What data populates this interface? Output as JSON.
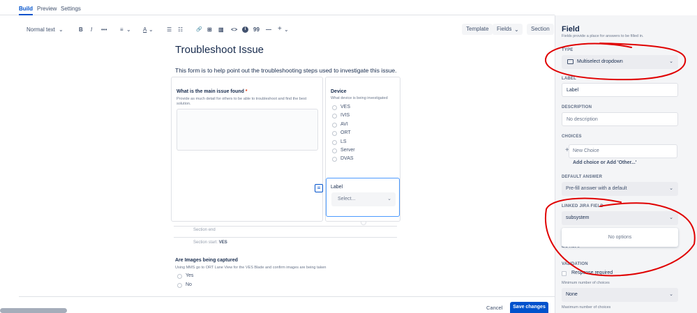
{
  "tabs": [
    {
      "label": "Build",
      "active": true
    },
    {
      "label": "Preview",
      "active": false
    },
    {
      "label": "Settings",
      "active": false
    }
  ],
  "toolbar": {
    "text_style": "Normal text",
    "text_style_chevron": "⌄",
    "bold": "B",
    "italic": "I",
    "more": "•••",
    "align": "≡",
    "align_chevron": "⌄",
    "text_color": "A",
    "color_chevron": "⌄",
    "bullet_list": "☰",
    "numbered_list": "☷",
    "link": "🔗",
    "table": "⊞",
    "layout": "▥",
    "code": "<>",
    "info": "i",
    "quote": "99",
    "divider": "—",
    "insert": "+",
    "insert_chevron": "⌄",
    "template_label": "Template",
    "fields_label": "Fields",
    "fields_chevron": "⌄",
    "section_label": "Section"
  },
  "form": {
    "title": "Troubleshoot Issue",
    "description": "This form is to help point out the troubleshooting steps used to investigate this issue.",
    "q_main_issue": {
      "title": "What is the main issue found",
      "required_mark": "*",
      "description": "Provide as much detail for others to be able to troubleshoot and find the best solution."
    },
    "q_device": {
      "title": "Device",
      "description": "What device is being investigated",
      "options": [
        "VES",
        "IVIS",
        "AVI",
        "ORT",
        "LS",
        "Server",
        "DVAS"
      ]
    },
    "q_label": {
      "title": "Label",
      "select_placeholder": "Select...",
      "chevron": "⌄"
    },
    "drag_handle_glyph": "≡",
    "section_end": "Section end",
    "section_start_prefix": "Section start:",
    "section_start_name": "VES",
    "q_images": {
      "title": "Are Images being captured",
      "description": "Using MMS go to ORT Lane View for the VES Blade and confirm images are being taken",
      "options": [
        "Yes",
        "No"
      ]
    },
    "cancel_label": "Cancel",
    "save_label": "Save changes"
  },
  "panel": {
    "title": "Field",
    "subtitle": "Fields provide a place for answers to be filled in.",
    "type_label": "TYPE",
    "type_value": "Multiselect dropdown",
    "type_chevron": "⌄",
    "label_label": "LABEL",
    "label_value": "Label",
    "description_label": "DESCRIPTION",
    "description_placeholder": "No description",
    "choices_label": "CHOICES",
    "choices_plus": "+",
    "new_choice_placeholder": "New Choice",
    "add_choice_text": "Add choice or Add 'Other...'",
    "default_answer_label": "DEFAULT ANSWER",
    "default_answer_value": "Pre-fill answer with a default",
    "default_chevron": "⌄",
    "linked_field_label": "LINKED JIRA FIELD",
    "linked_field_value": "subsystem",
    "linked_chevron": "⌄",
    "no_options": "No options",
    "hidden_partial": "Do not li",
    "validation_label": "VALIDATION",
    "response_required": "Response required",
    "min_choices_label": "Minimum number of choices",
    "min_choices_value": "None",
    "min_chevron": "⌄",
    "max_choices_label": "Maximum number of choices"
  },
  "colors": {
    "accent": "#0052cc",
    "annotation": "#e00000",
    "panel_bg": "#f4f5f7"
  }
}
